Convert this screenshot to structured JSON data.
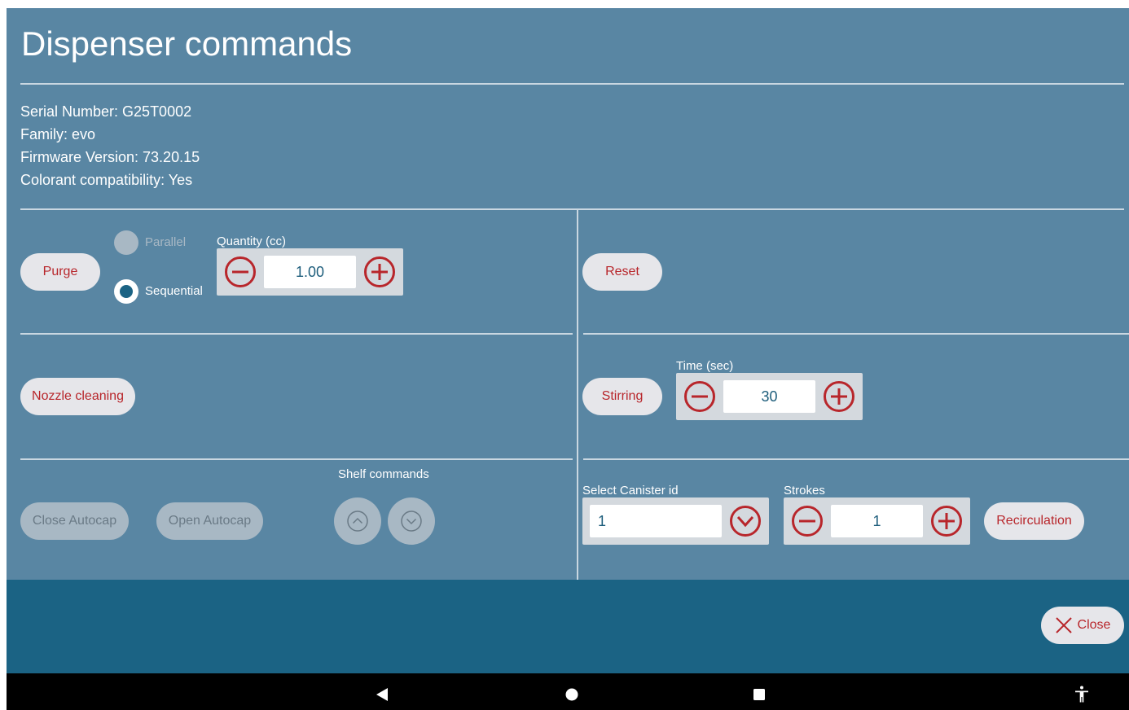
{
  "header": {
    "title": "Dispenser commands"
  },
  "info": {
    "serial": "Serial Number: G25T0002",
    "family": "Family: evo",
    "firmware": "Firmware Version: 73.20.15",
    "colorant": "Colorant compatibility: Yes"
  },
  "purge": {
    "button_label": "Purge",
    "radio_parallel": "Parallel",
    "radio_sequential": "Sequential",
    "selected_mode": "Sequential",
    "quantity_label": "Quantity (cc)",
    "quantity_value": "1.00"
  },
  "reset": {
    "button_label": "Reset"
  },
  "nozzle": {
    "button_label": "Nozzle cleaning"
  },
  "stirring": {
    "button_label": "Stirring",
    "time_label": "Time (sec)",
    "time_value": "30"
  },
  "autocap": {
    "close_label": "Close Autocap",
    "open_label": "Open Autocap"
  },
  "shelf": {
    "label": "Shelf commands",
    "up_icon": "chevron-up-circle-icon",
    "down_icon": "chevron-down-circle-icon"
  },
  "recirculation": {
    "canister_label": "Select Canister id",
    "canister_value": "1",
    "strokes_label": "Strokes",
    "strokes_value": "1",
    "button_label": "Recirculation"
  },
  "footer": {
    "close_label": "Close"
  },
  "colors": {
    "panel": "#5986a3",
    "footer": "#1b6384",
    "accent_red": "#b8262b",
    "value_text": "#1e5e7c"
  },
  "system_nav": [
    "back-icon",
    "home-icon",
    "recents-icon",
    "accessibility-icon"
  ]
}
